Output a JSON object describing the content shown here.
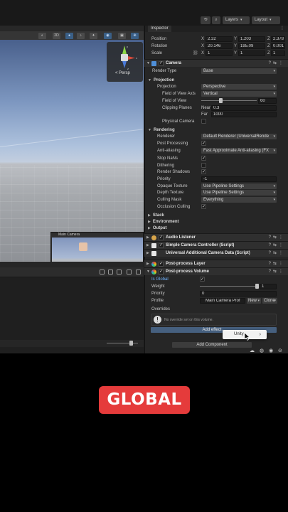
{
  "toolbar": {
    "history_icon": "history-icon",
    "search_icon": "search-icon",
    "layers_label": "Layers",
    "layout_label": "Layout"
  },
  "scene": {
    "mode_2d": "2D",
    "gizmo_label": "< Persp",
    "gizmo_axes": [
      "y",
      "x",
      "z"
    ],
    "camera_preview_title": "Main Camera"
  },
  "inspector": {
    "tab_label": "Inspector",
    "transform": {
      "rows": [
        {
          "label": "Position",
          "x": "2.32",
          "y": "1.203",
          "z": "2.378"
        },
        {
          "label": "Rotation",
          "x": "20.146",
          "y": "195.09",
          "z": "0.001"
        },
        {
          "label": "Scale",
          "x": "1",
          "y": "1",
          "z": "1"
        }
      ]
    },
    "camera": {
      "title": "Camera",
      "render_type_label": "Render Type",
      "render_type_value": "Base",
      "projection_header": "Projection",
      "projection_label": "Projection",
      "projection_value": "Perspective",
      "fov_axis_label": "Field of View Axis",
      "fov_axis_value": "Vertical",
      "fov_label": "Field of View",
      "fov_value": "60",
      "clipping_label": "Clipping Planes",
      "near_label": "Near",
      "near_value": "0.3",
      "far_label": "Far",
      "far_value": "1000",
      "physical_label": "Physical Camera",
      "rendering_header": "Rendering",
      "renderer_label": "Renderer",
      "renderer_value": "Default Renderer (UniversalRende",
      "post_label": "Post Processing",
      "aa_label": "Anti-aliasing",
      "aa_value": "Fast Approximate Anti-aliasing (FX",
      "stopnans_label": "Stop NaNs",
      "dither_label": "Dithering",
      "shadows_label": "Render Shadows",
      "priority_label": "Priority",
      "priority_value": "-1",
      "opaque_label": "Opaque Texture",
      "opaque_value": "Use Pipeline Settings",
      "depth_label": "Depth Texture",
      "depth_value": "Use Pipeline Settings",
      "culling_label": "Culling Mask",
      "culling_value": "Everything",
      "occlusion_label": "Occlusion Culling",
      "stack_header": "Stack",
      "env_header": "Environment",
      "output_header": "Output"
    },
    "components": {
      "audio": "Audio Listener",
      "simple_cam": "Simple Camera Controller (Script)",
      "urp_data": "Universal Additional Camera Data (Script)",
      "pp_layer": "Post-process Layer",
      "pp_volume": "Post-process Volume"
    },
    "volume": {
      "is_global_label": "Is Global",
      "weight_label": "Weight",
      "weight_value": "1",
      "priority_label": "Priority",
      "priority_value": "0",
      "profile_label": "Profile",
      "profile_value": "Main Camera Prof",
      "new_label": "New",
      "clone_label": "Clone",
      "overrides_label": "Overrides",
      "notice": "No override set on this volume.",
      "add_effect": "Add effect...",
      "popup_item": "Unity"
    },
    "add_component": "Add Component"
  },
  "banner": "GLOBAL",
  "colors": {
    "banner_bg": "#e53b3b",
    "accent_blue": "#46607f",
    "label_blue": "#6fb3ff"
  }
}
